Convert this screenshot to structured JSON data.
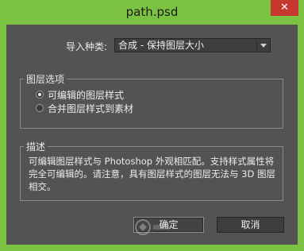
{
  "window": {
    "title": "path.psd",
    "close_glyph": "✕"
  },
  "import_type": {
    "label": "导入种类:",
    "selected": "合成 - 保持图层大小"
  },
  "layer_options": {
    "title": "图层选项",
    "options": [
      {
        "label": "可编辑的图层样式",
        "checked": true
      },
      {
        "label": "合并图层样式到素材",
        "checked": false
      }
    ]
  },
  "description": {
    "title": "描述",
    "text": "可编辑图层样式与 Photoshop 外观相匹配。支持样式属性将完全可编辑的。请注意，具有图层样式的图层无法与 3D 图层相交。"
  },
  "buttons": {
    "ok": "确定",
    "cancel": "取消"
  },
  "colors": {
    "title_bar": "#7cc242",
    "dialog_bg": "#535353",
    "close_button": "#c7372f"
  }
}
